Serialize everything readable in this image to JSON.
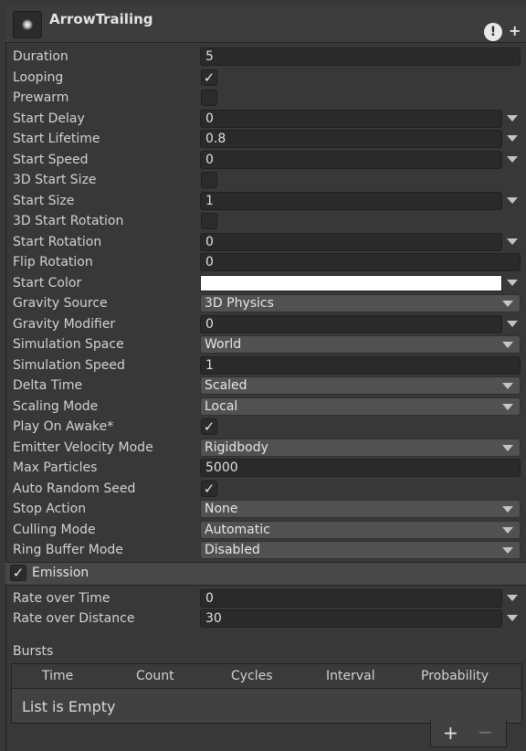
{
  "header": {
    "title": "ArrowTrailing",
    "warning_icon": "exclamation-icon",
    "add_icon": "plus-icon",
    "warn_glyph": "!",
    "add_glyph": "+"
  },
  "properties": {
    "duration": {
      "label": "Duration",
      "value": "5"
    },
    "looping": {
      "label": "Looping",
      "checked": true
    },
    "prewarm": {
      "label": "Prewarm",
      "checked": false
    },
    "start_delay": {
      "label": "Start Delay",
      "value": "0"
    },
    "start_lifetime": {
      "label": "Start Lifetime",
      "value": "0.8"
    },
    "start_speed": {
      "label": "Start Speed",
      "value": "0"
    },
    "start_size_3d": {
      "label": "3D Start Size",
      "checked": false
    },
    "start_size": {
      "label": "Start Size",
      "value": "1"
    },
    "start_rotation_3d": {
      "label": "3D Start Rotation",
      "checked": false
    },
    "start_rotation": {
      "label": "Start Rotation",
      "value": "0"
    },
    "flip_rotation": {
      "label": "Flip Rotation",
      "value": "0"
    },
    "start_color": {
      "label": "Start Color",
      "color": "#ffffff"
    },
    "gravity_source": {
      "label": "Gravity Source",
      "value": "3D Physics"
    },
    "gravity_modifier": {
      "label": "Gravity Modifier",
      "value": "0"
    },
    "simulation_space": {
      "label": "Simulation Space",
      "value": "World"
    },
    "simulation_speed": {
      "label": "Simulation Speed",
      "value": "1"
    },
    "delta_time": {
      "label": "Delta Time",
      "value": "Scaled"
    },
    "scaling_mode": {
      "label": "Scaling Mode",
      "value": "Local"
    },
    "play_on_awake": {
      "label": "Play On Awake*",
      "checked": true
    },
    "emitter_velocity_mode": {
      "label": "Emitter Velocity Mode",
      "value": "Rigidbody"
    },
    "max_particles": {
      "label": "Max Particles",
      "value": "5000"
    },
    "auto_random_seed": {
      "label": "Auto Random Seed",
      "checked": true
    },
    "stop_action": {
      "label": "Stop Action",
      "value": "None"
    },
    "culling_mode": {
      "label": "Culling Mode",
      "value": "Automatic"
    },
    "ring_buffer_mode": {
      "label": "Ring Buffer Mode",
      "value": "Disabled"
    }
  },
  "emission": {
    "label": "Emission",
    "enabled": true,
    "rate_over_time": {
      "label": "Rate over Time",
      "value": "0"
    },
    "rate_over_distance": {
      "label": "Rate over Distance",
      "value": "30"
    },
    "bursts": {
      "label": "Bursts",
      "columns": [
        "Time",
        "Count",
        "Cycles",
        "Interval",
        "Probability"
      ],
      "empty_text": "List is Empty",
      "add_glyph": "+",
      "remove_glyph": "−"
    }
  },
  "check_glyph": "✓"
}
